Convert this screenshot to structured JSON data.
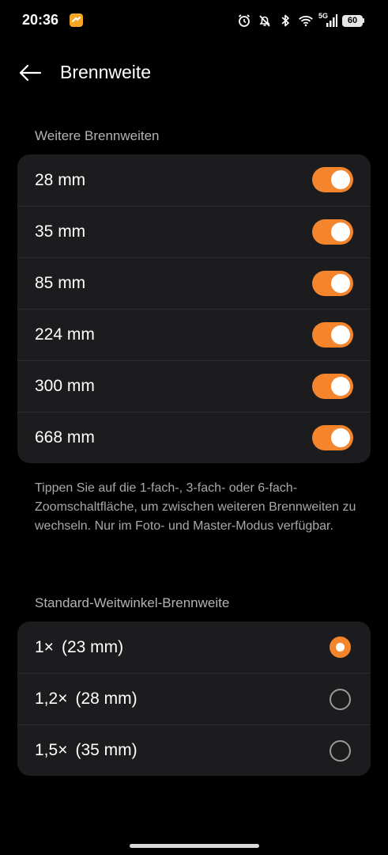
{
  "status_bar": {
    "time": "20:36",
    "network": "5G",
    "battery": "60"
  },
  "header": {
    "title": "Brennweite"
  },
  "more_focal_lengths": {
    "title": "Weitere Brennweiten",
    "items": [
      {
        "label": "28 mm",
        "enabled": true
      },
      {
        "label": "35 mm",
        "enabled": true
      },
      {
        "label": "85 mm",
        "enabled": true
      },
      {
        "label": "224 mm",
        "enabled": true
      },
      {
        "label": "300 mm",
        "enabled": true
      },
      {
        "label": "668 mm",
        "enabled": true
      }
    ],
    "hint": "Tippen Sie auf die 1-fach-, 3-fach- oder 6-fach-Zoomschaltfläche, um zwischen weiteren Brennweiten zu wechseln. Nur im Foto- und Master-Modus verfügbar."
  },
  "default_wide": {
    "title": "Standard-Weitwinkel-Brennweite",
    "options": [
      {
        "factor": "1×",
        "mm": "(23 mm)",
        "selected": true
      },
      {
        "factor": "1,2×",
        "mm": "(28 mm)",
        "selected": false
      },
      {
        "factor": "1,5×",
        "mm": "(35 mm)",
        "selected": false
      }
    ]
  },
  "colors": {
    "accent": "#f5852c",
    "background": "#000000",
    "card": "#1c1c1e"
  }
}
